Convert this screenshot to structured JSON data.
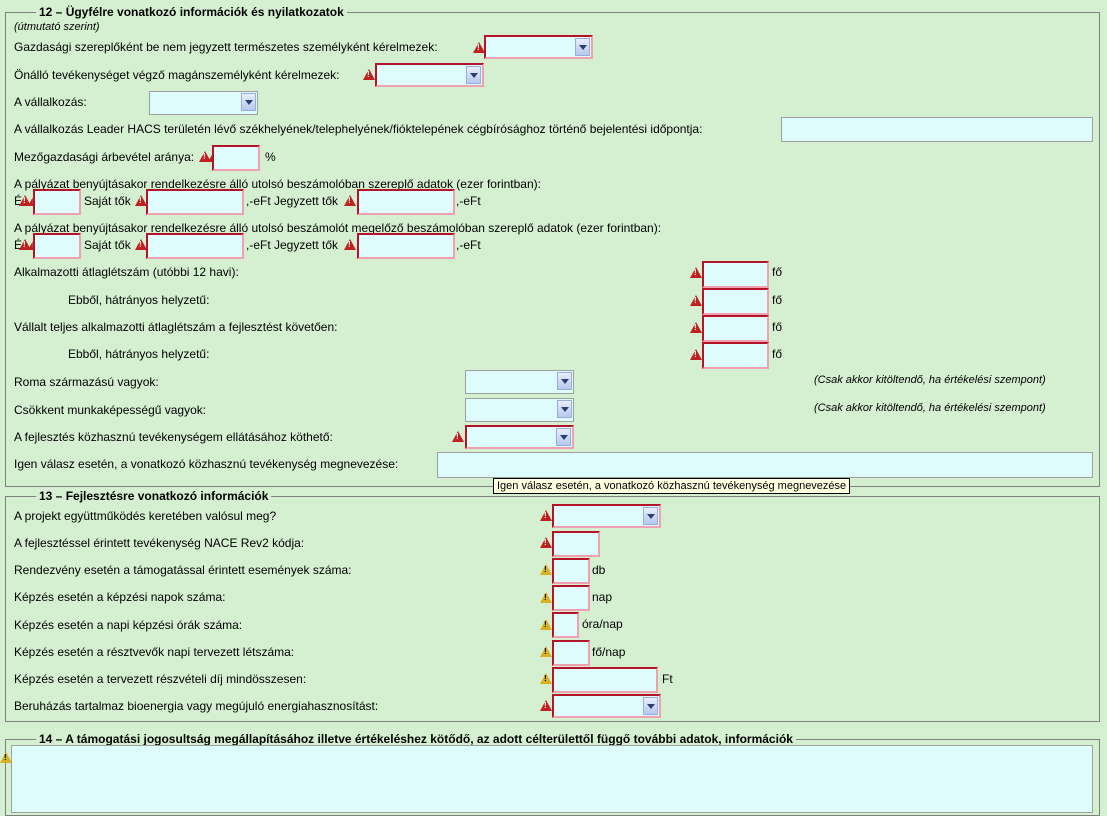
{
  "s12": {
    "legend": "12 – Ügyfélre vonatkozó információk és nyilatkozatok",
    "hint": "(útmutató szerint)",
    "row_gazd": "Gazdasági szereplőként be nem jegyzett természetes személyként kérelmezek:",
    "row_onallo": "Önálló tevékenységet végző magánszemélyként kérelmezek:",
    "row_vallalkozas": "A vállalkozás:",
    "row_leader": "A vállalkozás Leader HACS területén lévő székhelyének/telephelyének/fióktelepének cégbírósághoz történő bejelentési időpontja:",
    "row_mezogazd": "Mezőgazdasági árbevétel aránya:",
    "percent": "%",
    "row_beszamolo1": "A pályázat benyújtásakor rendelkezésre álló utolsó beszámolóban szereplő adatok (ezer forintban):",
    "row_beszamolo2": "A pályázat benyújtásakor rendelkezésre álló utolsó beszámolót megelőző beszámolóban szereplő adatok (ezer forintban):",
    "e_label": "É",
    "sajat_tok": "Saját tők",
    "eft_jegyzett": ",-eFt Jegyzett tők",
    "eft": ",-eFt",
    "row_alkalmazotti": "Alkalmazotti átlaglétszám (utóbbi 12 havi):",
    "row_hatranyos": "Ebből, hátrányos helyzetű:",
    "row_vallalt": "Vállalt teljes alkalmazotti átlaglétszám a fejlesztést követően:",
    "fo": "fő",
    "row_roma": "Roma származású vagyok:",
    "row_csokkent": "Csökkent munkaképességű vagyok:",
    "csak_akkor": "(Csak akkor kitöltendő, ha értékelési szempont)",
    "row_kozhasznu": "A fejlesztés közhasznú tevékenységem ellátásához köthető:",
    "row_igen": "Igen válasz esetén, a vonatkozó közhasznú tevékenység megnevezése:",
    "tooltip": "Igen válasz esetén, a vonatkozó közhasznú tevékenység megnevezése"
  },
  "s13": {
    "legend": "13 – Fejlesztésre vonatkozó információk",
    "row_projekt": "A projekt együttműködés keretében valósul meg?",
    "row_nace": "A fejlesztéssel érintett tevékenység NACE Rev2 kódja:",
    "row_rendezveny": "Rendezvény esetén a támogatással érintett események száma:",
    "unit_db": "db",
    "row_kepzesi_napok": "Képzés esetén a képzési napok száma:",
    "unit_nap": "nap",
    "row_napi_orak": "Képzés esetén a napi képzési órák száma:",
    "unit_ora": "óra/nap",
    "row_resztvevok": "Képzés esetén a résztvevők napi tervezett létszáma:",
    "unit_fo_nap": "fő/nap",
    "row_dij": "Képzés esetén a tervezett részvételi díj mindösszesen:",
    "unit_ft": "Ft",
    "row_bioenergia": "Beruházás tartalmaz bioenergia vagy megújuló energiahasznosítást:"
  },
  "s14": {
    "legend": "14 – A támogatási jogosultság megállapításához illetve értékeléshez kötődő, az adott célterülettől függő további adatok, információk"
  }
}
